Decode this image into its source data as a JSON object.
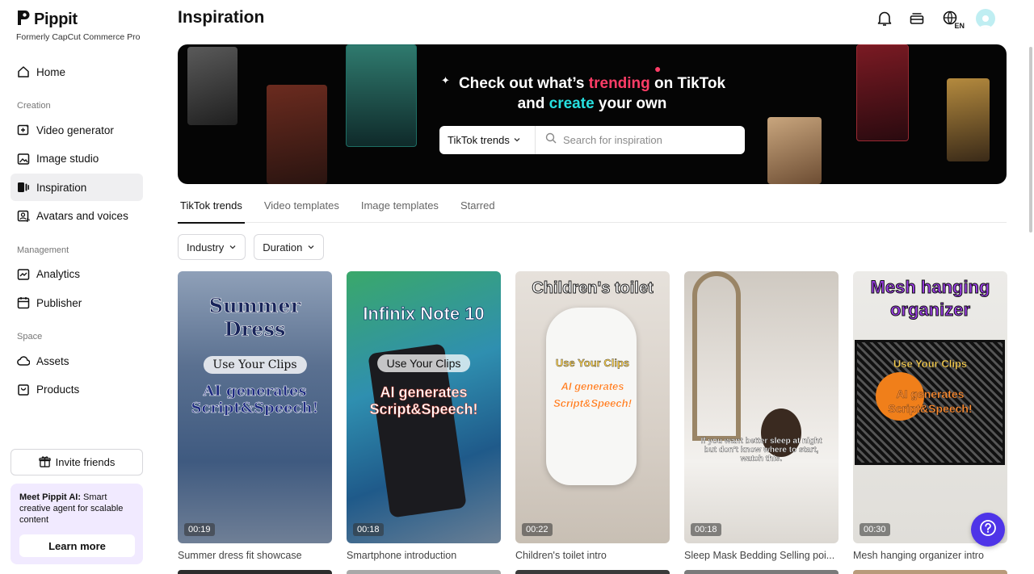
{
  "brand": {
    "name": "Pippit",
    "subtitle": "Formerly CapCut Commerce Pro"
  },
  "nav": {
    "home": "Home",
    "section_creation": "Creation",
    "video_generator": "Video generator",
    "image_studio": "Image studio",
    "inspiration": "Inspiration",
    "avatars_voices": "Avatars and voices",
    "section_management": "Management",
    "analytics": "Analytics",
    "publisher": "Publisher",
    "section_space": "Space",
    "assets": "Assets",
    "products": "Products"
  },
  "invite_label": "Invite friends",
  "promo": {
    "bold": "Meet Pippit AI:",
    "text": " Smart creative agent for scalable content",
    "button": "Learn more"
  },
  "header": {
    "title": "Inspiration",
    "lang_badge": "EN"
  },
  "hero": {
    "line1_pre": "Check out what’s ",
    "line1_trending": "trending",
    "line1_post": " on TikTok",
    "line2_pre": "and ",
    "line2_create": "create",
    "line2_post": " your own",
    "select_value": "TikTok trends",
    "search_placeholder": "Search for inspiration"
  },
  "tabs": [
    "TikTok trends",
    "Video templates",
    "Image templates",
    "Starred"
  ],
  "filters": {
    "industry": "Industry",
    "duration": "Duration"
  },
  "cards": [
    {
      "title": "Summer dress fit showcase",
      "duration": "00:19",
      "overlay_title": "Summer Dress",
      "pill": "Use Your Clips",
      "ai_text": "AI generates Script&Speech!"
    },
    {
      "title": "Smartphone introduction",
      "duration": "00:18",
      "overlay_title": "Infinix Note 10",
      "pill": "Use Your Clips",
      "ai_text": "AI generates Script&Speech!"
    },
    {
      "title": "Children's toilet intro",
      "duration": "00:22",
      "overlay_title": "Children's toilet",
      "pill": "Use Your Clips",
      "ai_text": "AI generates Script&Speech!"
    },
    {
      "title": "Sleep Mask Bedding Selling poi...",
      "duration": "00:18",
      "caption": "If you want better sleep at night but don't know where to start, watch this."
    },
    {
      "title": "Mesh hanging organizer intro",
      "duration": "00:30",
      "overlay_title": "Mesh hanging organizer",
      "pill": "Use Your Clips",
      "ai_text": "AI generates Script&Speech!"
    }
  ],
  "colors": {
    "accent_pink": "#ff3d67",
    "accent_cyan": "#27e0e0",
    "help_button": "#4e34e8"
  }
}
